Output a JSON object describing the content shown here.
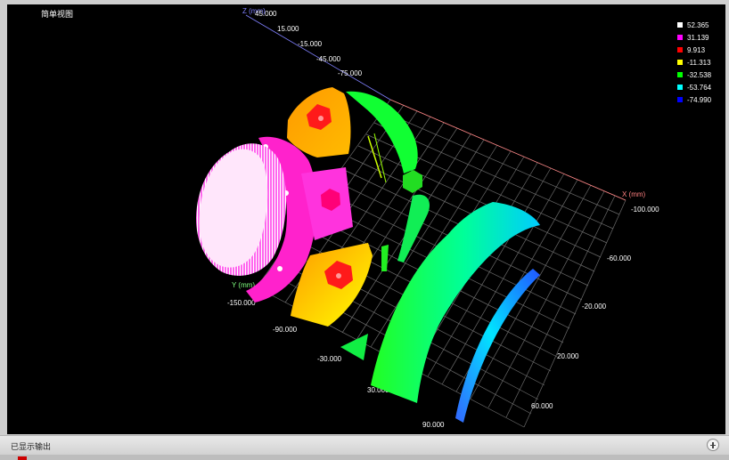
{
  "view": {
    "title": "简单视图"
  },
  "axes": {
    "z": {
      "label": "Z (mm)",
      "ticks": [
        "45.000",
        "15.000",
        "-15.000",
        "-45.000",
        "-75.000"
      ],
      "color": "#8080ff"
    },
    "x": {
      "label": "X (mm)",
      "ticks": [
        "-100.000",
        "-60.000",
        "-20.000",
        "20.000",
        "60.000"
      ],
      "color": "#ff8080"
    },
    "y": {
      "label": "Y (mm)",
      "ticks": [
        "-150.000",
        "-90.000",
        "-30.000",
        "30.000",
        "90.000"
      ],
      "color": "#80ff80"
    }
  },
  "legend": {
    "items": [
      {
        "value": "52.365",
        "color": "#ffffff"
      },
      {
        "value": "31.139",
        "color": "#ff00ff"
      },
      {
        "value": "9.913",
        "color": "#ff0000"
      },
      {
        "value": "-11.313",
        "color": "#ffff00"
      },
      {
        "value": "-32.538",
        "color": "#00ff00"
      },
      {
        "value": "-53.764",
        "color": "#00ffff"
      },
      {
        "value": "-74.990",
        "color": "#0000ff"
      }
    ]
  },
  "status": {
    "text": "已显示输出",
    "expand_icon": "plus-circle-icon"
  }
}
